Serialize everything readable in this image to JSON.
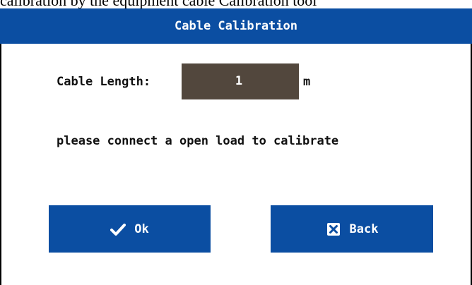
{
  "caption": "calibration by the equipment cable Calibration tool",
  "dialog": {
    "title": "Cable Calibration",
    "cable_length_label": "Cable Length:",
    "cable_length_value": "1",
    "unit": "m",
    "instruction": "please connect a open load to calibrate",
    "colors": {
      "accent": "#0b4ea2",
      "input_bg": "#52473d",
      "text": "#111111"
    }
  },
  "buttons": {
    "ok": {
      "label": "Ok",
      "icon": "check-icon"
    },
    "back": {
      "label": "Back",
      "icon": "close-box-icon"
    }
  }
}
